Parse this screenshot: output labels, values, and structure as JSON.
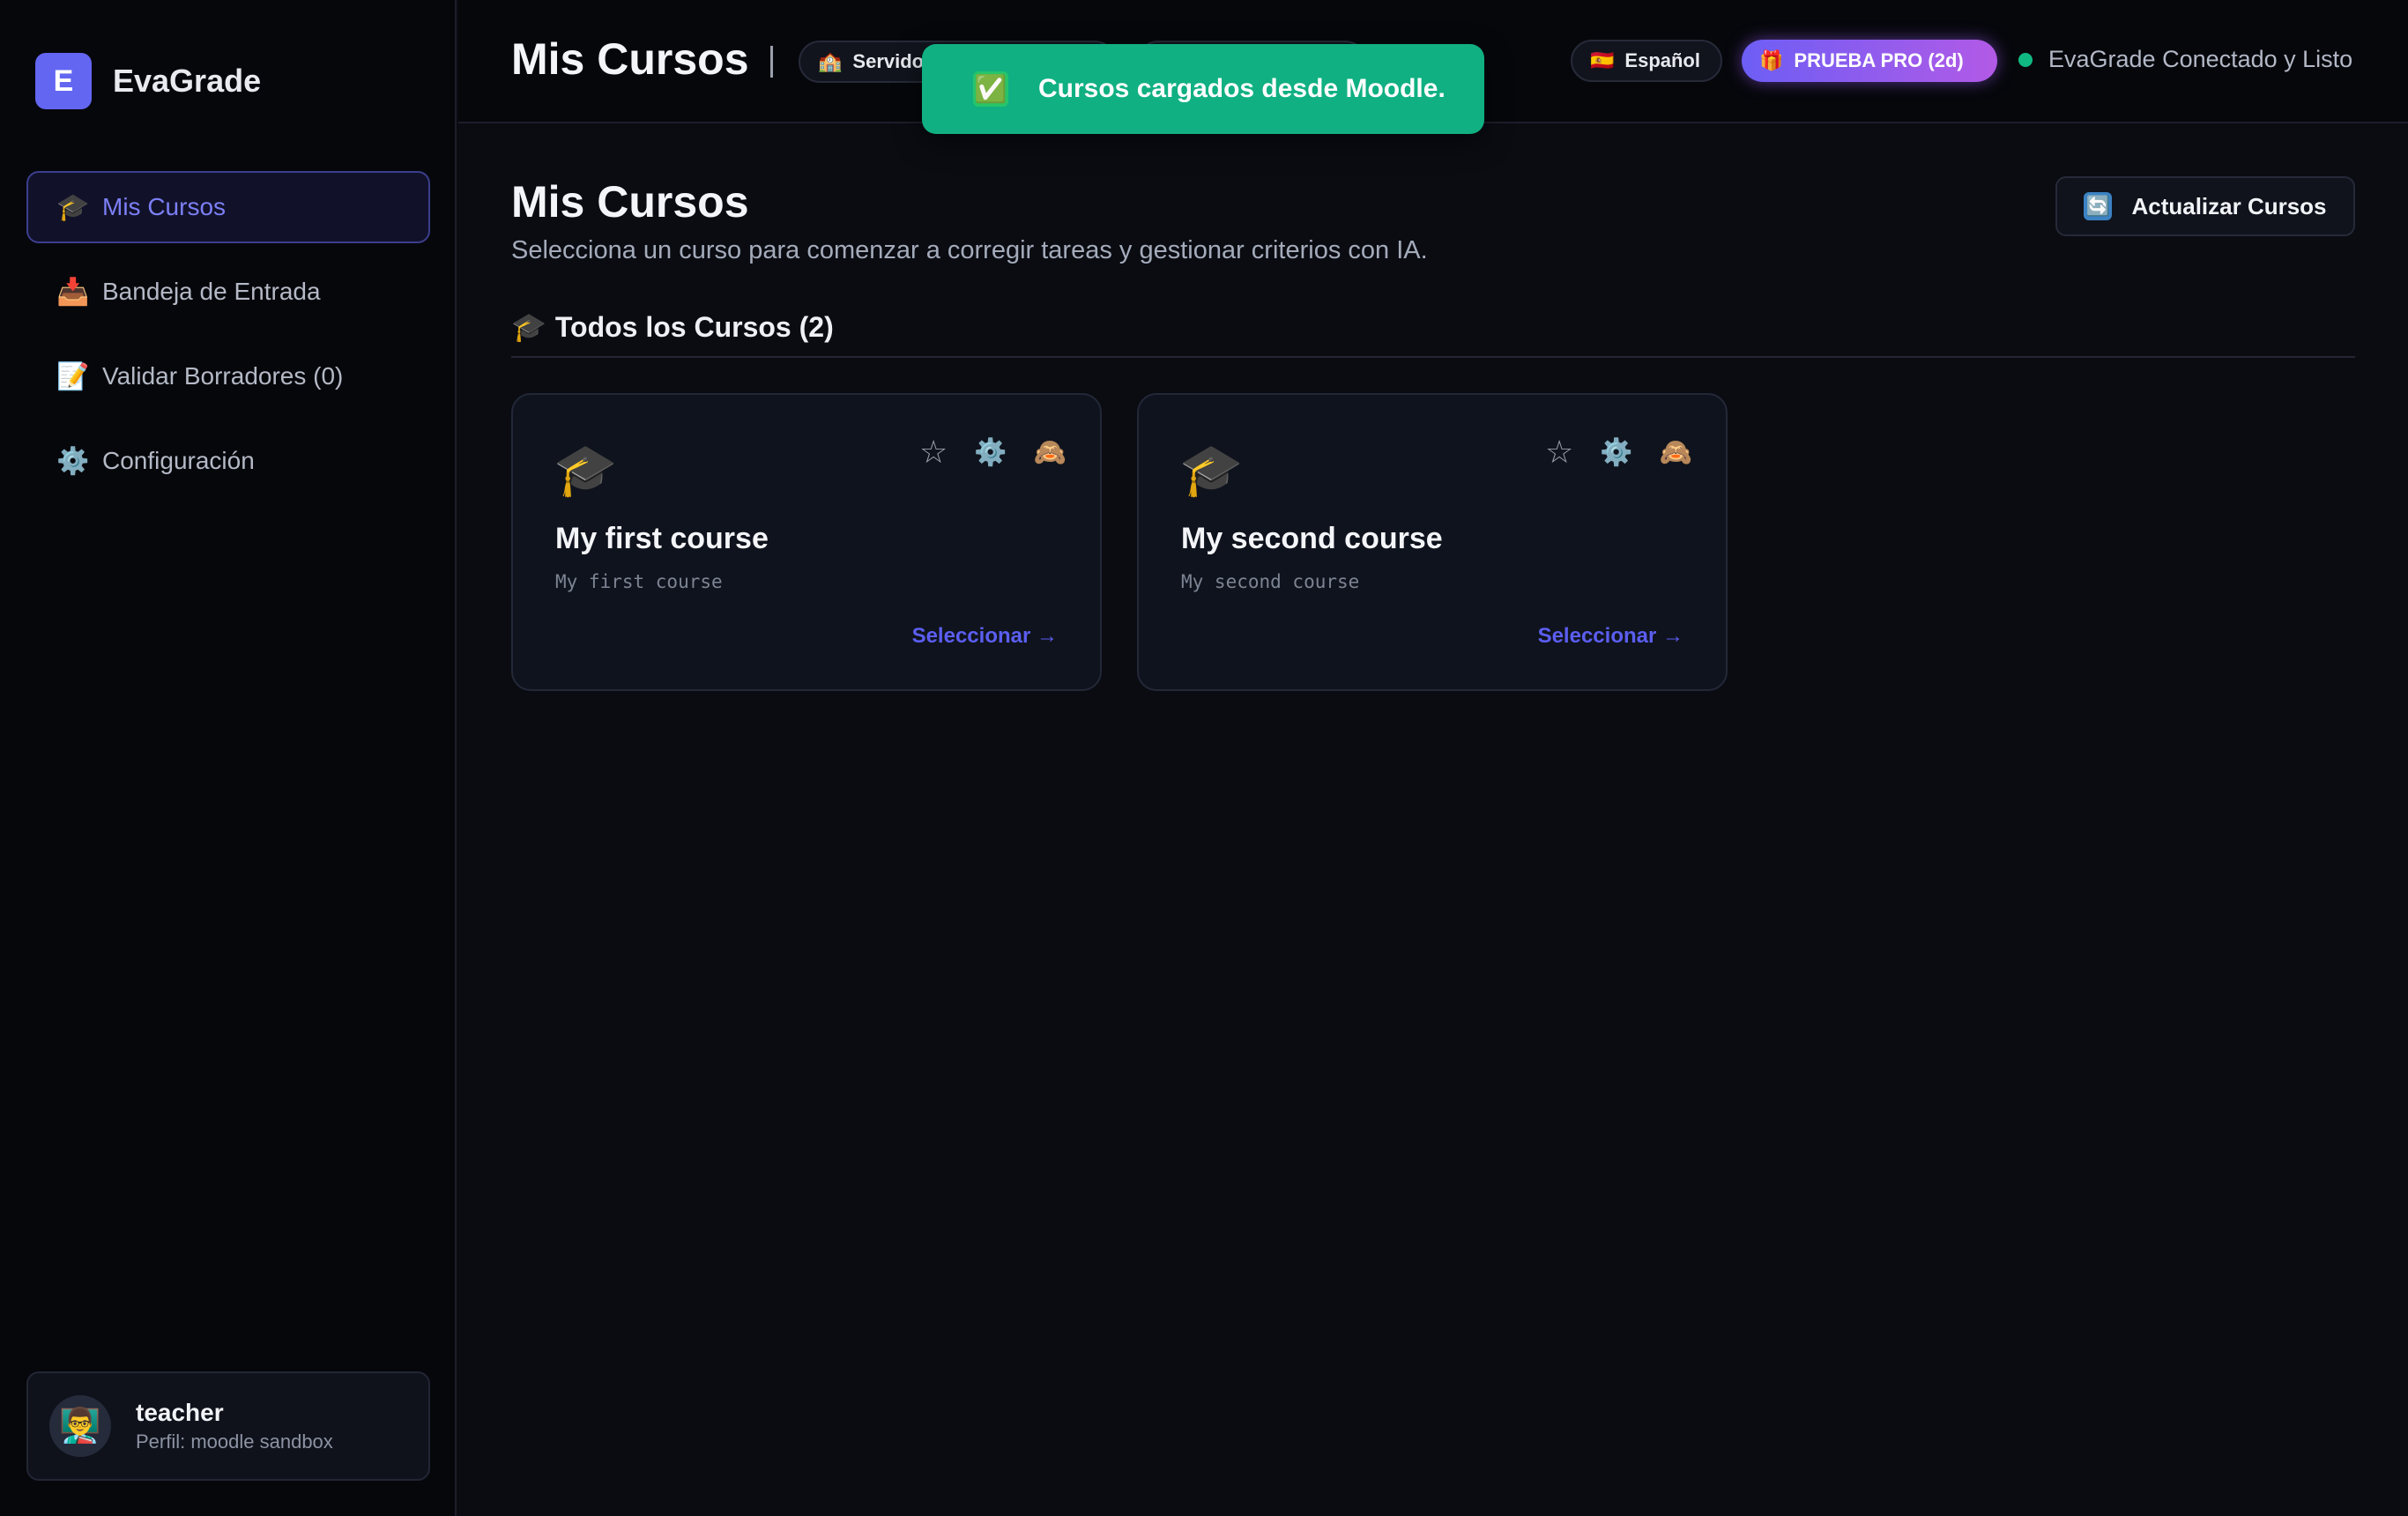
{
  "app": {
    "logo_letter": "E",
    "name": "EvaGrade"
  },
  "sidebar": {
    "items": [
      {
        "icon": "🎓",
        "label": "Mis Cursos",
        "active": true
      },
      {
        "icon": "📥",
        "label": "Bandeja de Entrada"
      },
      {
        "icon": "📝",
        "label": "Validar Borradores (0)"
      },
      {
        "icon": "⚙️",
        "label": "Configuración"
      }
    ],
    "profile": {
      "avatar": "👨‍🏫",
      "name": "teacher",
      "subtitle": "Perfil: moodle sandbox"
    }
  },
  "topbar": {
    "title": "Mis Cursos",
    "server_pill": {
      "icon": "🏫",
      "label": "Servidor"
    },
    "language": {
      "flag": "🇪🇸",
      "label": "Español"
    },
    "pro_badge": {
      "icon": "🎁",
      "label": "PRUEBA PRO (2d)"
    },
    "status": {
      "label": "EvaGrade Conectado y Listo",
      "color": "#10b981"
    }
  },
  "toast": {
    "icon": "✅",
    "message": "Cursos cargados desde Moodle."
  },
  "main": {
    "title": "Mis Cursos",
    "subtitle": "Selecciona un curso para comenzar a corregir tareas y gestionar criterios con IA.",
    "refresh_button": {
      "icon": "🔄",
      "label": "Actualizar Cursos"
    },
    "section": {
      "icon": "🎓",
      "title": "Todos los Cursos (2)"
    },
    "courses": [
      {
        "icon": "🎓",
        "name": "My first course",
        "shortname": "My first course",
        "select_label": "Seleccionar →"
      },
      {
        "icon": "🎓",
        "name": "My second course",
        "shortname": "My second course",
        "select_label": "Seleccionar →"
      }
    ],
    "card_actions": {
      "favorite": "☆",
      "settings": "⚙️",
      "hide": "🙈"
    }
  },
  "colors": {
    "accent": "#6366f1",
    "toast": "#10b082",
    "status_ok": "#10b981"
  }
}
